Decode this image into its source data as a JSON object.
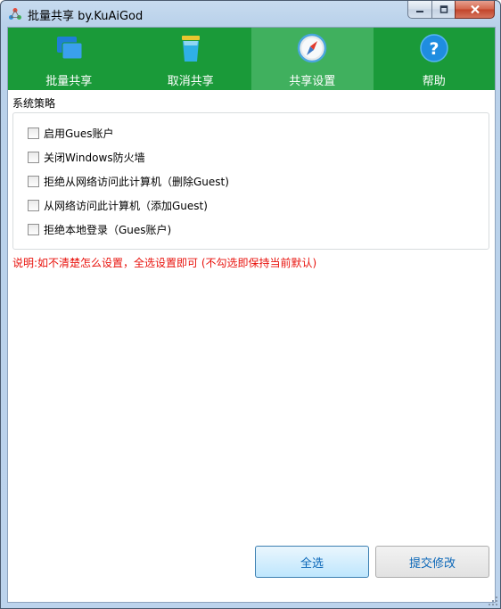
{
  "window": {
    "title": "批量共享 by.KuAiGod"
  },
  "tabs": [
    {
      "label": "批量共享",
      "icon": "windows-tiles-icon",
      "active": false
    },
    {
      "label": "取消共享",
      "icon": "recycle-bin-icon",
      "active": false
    },
    {
      "label": "共享设置",
      "icon": "compass-icon",
      "active": true
    },
    {
      "label": "帮助",
      "icon": "help-question-icon",
      "active": false
    }
  ],
  "policy": {
    "title": "系统策略",
    "options": [
      {
        "label": "启用Gues账户",
        "checked": false
      },
      {
        "label": "关闭Windows防火墙",
        "checked": false
      },
      {
        "label": "拒绝从网络访问此计算机（删除Guest)",
        "checked": false
      },
      {
        "label": "从网络访问此计算机（添加Guest)",
        "checked": false
      },
      {
        "label": "拒绝本地登录（Gues账户)",
        "checked": false
      }
    ]
  },
  "note": "说明:如不清楚怎么设置，全选设置即可 (不勾选即保持当前默认)",
  "buttons": {
    "select_all": "全选",
    "submit": "提交修改"
  },
  "colors": {
    "tabbar": "#1a9a39",
    "tab_active": "#40b05e",
    "note": "#e8120c",
    "button_text": "#0b67b8"
  }
}
